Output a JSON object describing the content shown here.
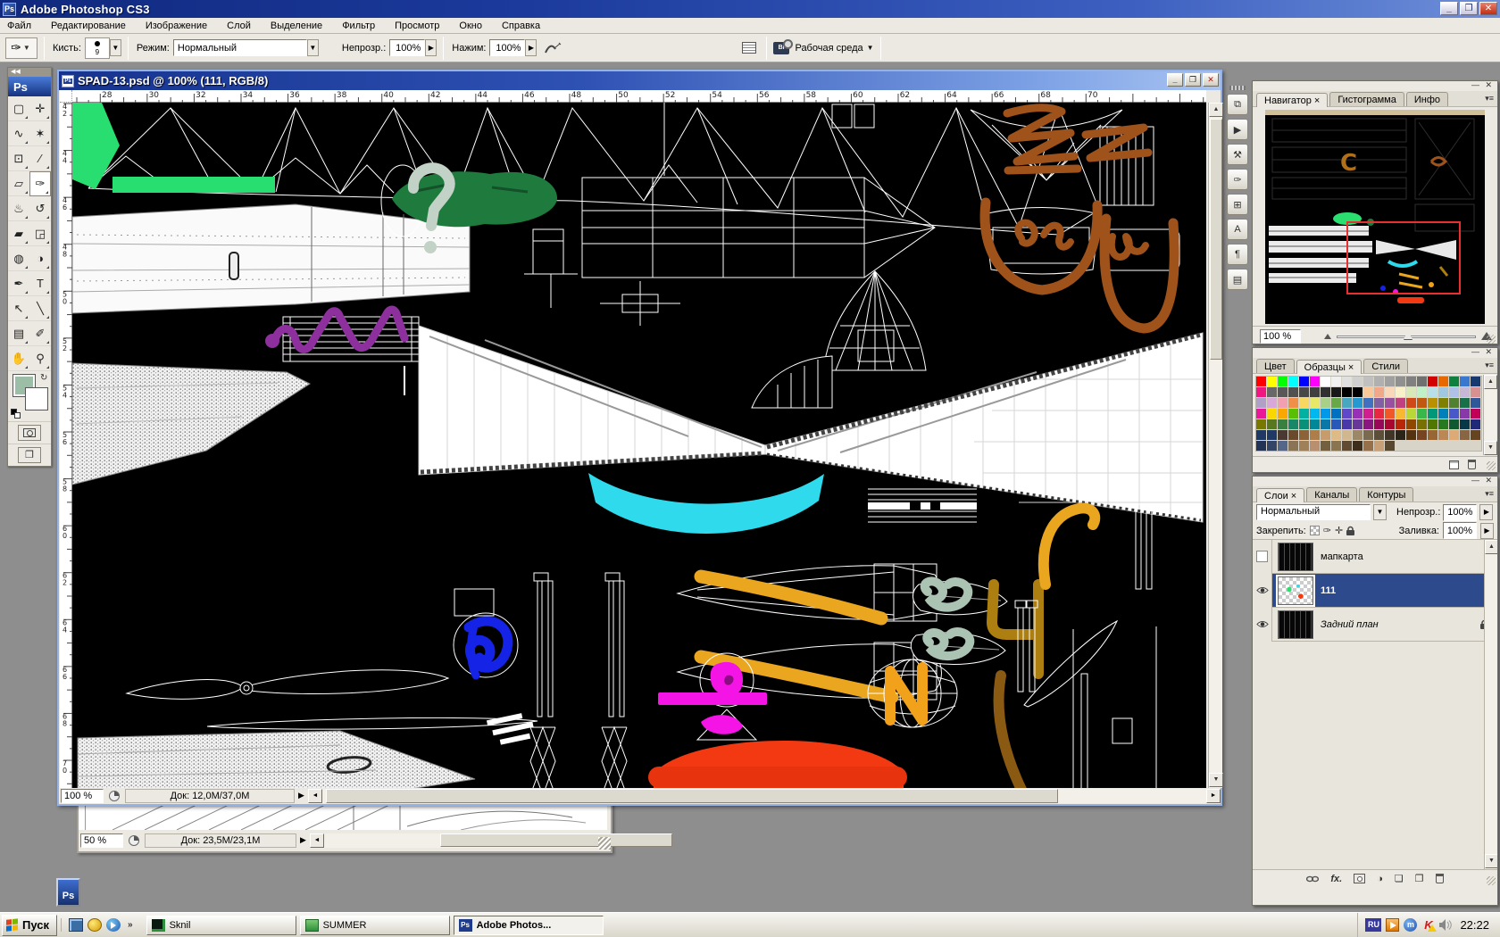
{
  "window": {
    "title": "Adobe Photoshop CS3",
    "badge": "Ps"
  },
  "menu": {
    "items": [
      "Файл",
      "Редактирование",
      "Изображение",
      "Слой",
      "Выделение",
      "Фильтр",
      "Просмотр",
      "Окно",
      "Справка"
    ]
  },
  "options": {
    "brush_label": "Кисть:",
    "brush_size": "9",
    "mode_label": "Режим:",
    "mode_value": "Нормальный",
    "opacity_label": "Непрозр.:",
    "opacity_value": "100%",
    "flow_label": "Нажим:",
    "flow_value": "100%",
    "workspace_label": "Рабочая среда"
  },
  "tools": [
    {
      "name": "rectangular-marquee",
      "glyph": "▢"
    },
    {
      "name": "move",
      "glyph": "✛"
    },
    {
      "name": "lasso",
      "glyph": "∿"
    },
    {
      "name": "magic-wand",
      "glyph": "✶"
    },
    {
      "name": "crop",
      "glyph": "⊡"
    },
    {
      "name": "slice",
      "glyph": "∕"
    },
    {
      "name": "healing-brush",
      "glyph": "▱"
    },
    {
      "name": "brush",
      "glyph": "✑",
      "selected": true
    },
    {
      "name": "clone-stamp",
      "glyph": "♨"
    },
    {
      "name": "history-brush",
      "glyph": "↺"
    },
    {
      "name": "eraser",
      "glyph": "▰"
    },
    {
      "name": "paint-bucket",
      "glyph": "◲"
    },
    {
      "name": "blur",
      "glyph": "◍"
    },
    {
      "name": "dodge",
      "glyph": "◑"
    },
    {
      "name": "pen",
      "glyph": "✒"
    },
    {
      "name": "type",
      "glyph": "T"
    },
    {
      "name": "path-selection",
      "glyph": "↖"
    },
    {
      "name": "line",
      "glyph": "╲"
    },
    {
      "name": "notes",
      "glyph": "▤"
    },
    {
      "name": "eyedropper",
      "glyph": "✐"
    },
    {
      "name": "hand",
      "glyph": "✋"
    },
    {
      "name": "zoom",
      "glyph": "⚲"
    }
  ],
  "toolbox_colors": {
    "foreground": "#9CBEA6",
    "background": "#FFFFFF"
  },
  "doc1": {
    "title": "SPAD-13.psd @ 100% (111, RGB/8)",
    "zoom": "100 %",
    "size": "Док: 12,0М/37,0М",
    "ruler_h": [
      "28",
      "30",
      "32",
      "34",
      "36",
      "38",
      "40",
      "42",
      "44",
      "46",
      "48",
      "50",
      "52",
      "54",
      "56",
      "58",
      "60",
      "62",
      "64",
      "66",
      "68",
      "70"
    ],
    "ruler_v": [
      "42",
      "44",
      "46",
      "48",
      "50",
      "52",
      "54",
      "56",
      "58",
      "60",
      "62",
      "64",
      "66",
      "68",
      "70"
    ]
  },
  "doc2": {
    "zoom": "50 %",
    "size": "Док: 23,5М/23,1М"
  },
  "ps_tile": {
    "label": "Ps"
  },
  "dock": {
    "items": [
      {
        "name": "layer-comps",
        "glyph": "⧉"
      },
      {
        "name": "actions",
        "glyph": "▶"
      },
      {
        "name": "tool-presets",
        "glyph": "⚒"
      },
      {
        "name": "brushes",
        "glyph": "✑"
      },
      {
        "name": "clone-source",
        "glyph": "⊞"
      },
      {
        "name": "character",
        "glyph": "A"
      },
      {
        "name": "paragraph",
        "glyph": "¶"
      },
      {
        "name": "info-well",
        "glyph": "▤"
      }
    ]
  },
  "navigator": {
    "tabs": [
      "Навигатор",
      "Гистограмма",
      "Инфо"
    ],
    "active_tab": 0,
    "zoom": "100 %"
  },
  "swatches": {
    "tabs": [
      "Цвет",
      "Образцы",
      "Стили"
    ],
    "active_tab": 1,
    "colors": [
      "#FF0000",
      "#FFFF00",
      "#00FF00",
      "#00FFFF",
      "#0000FF",
      "#FF00FF",
      "#FFFFFF",
      "#F0F0F0",
      "#E0E0E0",
      "#D0D0D0",
      "#C0C0C0",
      "#B0B0B0",
      "#A0A0A0",
      "#909090",
      "#808080",
      "#707070",
      "#D40000",
      "#E86800",
      "#108040",
      "#3878D0",
      "#183870",
      "#F01880",
      "#686868",
      "#585858",
      "#505050",
      "#484848",
      "#404040",
      "#303030",
      "#181818",
      "#000000",
      "#000000",
      "#F8C898",
      "#F0A888",
      "#F8D8B8",
      "#F8F0C8",
      "#D8E8B8",
      "#C0F0C8",
      "#B8E0E8",
      "#A0C8E0",
      "#B0C0E8",
      "#C8B8D8",
      "#D89090",
      "#B0A0C8",
      "#D8A8D8",
      "#F0A0B0",
      "#F09048",
      "#F8D860",
      "#E8E868",
      "#A8D088",
      "#68A848",
      "#48A8C0",
      "#2898D0",
      "#4070C0",
      "#8060A0",
      "#9850A0",
      "#C04080",
      "#D04818",
      "#C05810",
      "#B89000",
      "#808000",
      "#508030",
      "#187048",
      "#305898",
      "#E81898",
      "#F8D800",
      "#F8A800",
      "#58C000",
      "#00B0A0",
      "#00B8F0",
      "#0098E8",
      "#0070C0",
      "#6048C8",
      "#9830B8",
      "#D02090",
      "#E82840",
      "#F05828",
      "#F8B830",
      "#B8D838",
      "#38B848",
      "#009878",
      "#0080B8",
      "#4858C8",
      "#8838A8",
      "#C00058",
      "#787800",
      "#587820",
      "#388040",
      "#188868",
      "#089078",
      "#008898",
      "#0878A8",
      "#2858B8",
      "#4838A8",
      "#683898",
      "#881880",
      "#980858",
      "#A80830",
      "#B82808",
      "#904800",
      "#787000",
      "#507800",
      "#287820",
      "#105830",
      "#083848",
      "#202878",
      "#1F3864",
      "#203864",
      "#4A3933",
      "#6B4A2B",
      "#8C6239",
      "#AD7D4A",
      "#C69C6D",
      "#DEBA85",
      "#D0B78F",
      "#9C8866",
      "#7A6A4F",
      "#5C4F3A",
      "#403627",
      "#2B2418",
      "#553311",
      "#774422",
      "#996633",
      "#BB8855",
      "#DDAA77",
      "#886644",
      "#664422",
      "#223355",
      "#334466",
      "#556688",
      "#8B7355",
      "#A08058",
      "#B89070",
      "#73603F",
      "#8A7550",
      "#614C33",
      "#3D2E1C",
      "#96704B",
      "#C8A078",
      "#584830"
    ]
  },
  "layers": {
    "tabs": [
      "Слои",
      "Каналы",
      "Контуры"
    ],
    "active_tab": 0,
    "blend_mode": "Нормальный",
    "opacity_label": "Непрозр.:",
    "opacity_value": "100%",
    "lock_label": "Закрепить:",
    "fill_label": "Заливка:",
    "fill_value": "100%",
    "items": [
      {
        "name": "мапкарта",
        "visible": false,
        "selected": false,
        "locked": false,
        "thumb": "dark",
        "italic": false
      },
      {
        "name": "111",
        "visible": true,
        "selected": true,
        "locked": false,
        "thumb": "checker",
        "italic": false
      },
      {
        "name": "Задний план",
        "visible": true,
        "selected": false,
        "locked": true,
        "thumb": "dark",
        "italic": true
      }
    ]
  },
  "canvas_paint": {
    "bright_green": "#28DE70",
    "dark_green": "#1F7B3D",
    "sage_gray": "#C2D2C6",
    "purple": "#8E2F9E",
    "pink": "#DFA8DF",
    "cyan": "#2EDAEC",
    "orange": "#EBA61F",
    "mustard": "#AD7E10",
    "brown": "#A0521B",
    "blue": "#1523E6",
    "magenta": "#F414E6",
    "red": "#F23912",
    "sage_green": "#ABC3B3"
  },
  "taskbar": {
    "start_label": "Пуск",
    "tasks": [
      {
        "label": "Sknil",
        "icon": "sknil",
        "active": false
      },
      {
        "label": "SUMMER",
        "icon": "folder",
        "active": false
      },
      {
        "label": "Adobe Photos...",
        "icon": "ps",
        "active": true
      }
    ],
    "tray_language": "RU",
    "clock": "22:22"
  }
}
